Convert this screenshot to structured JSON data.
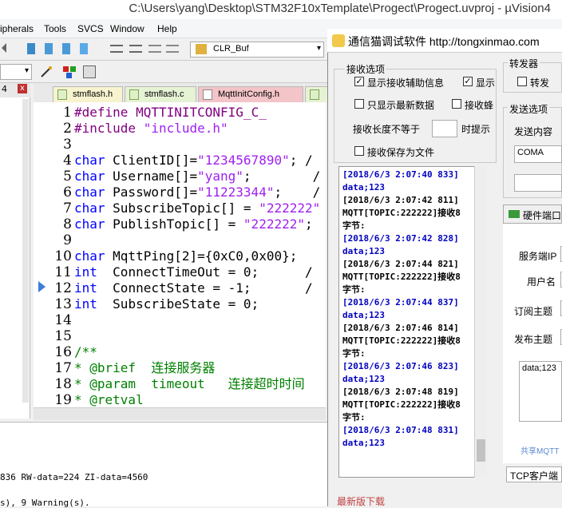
{
  "keil": {
    "title": "C:\\Users\\yang\\Desktop\\STM32F10xTemplate\\Progect\\Progect.uvproj - µVision4",
    "menu": [
      "ipherals",
      "Tools",
      "SVCS",
      "Window",
      "Help"
    ],
    "target_combo": "CLR_Buf",
    "tabs": [
      "stmflash.h",
      "stmflash.c",
      "MqttInitConfig.h"
    ],
    "code_lines": [
      {
        "n": "1",
        "text": "#define MQTTINITCONFIG_C_"
      },
      {
        "n": "2",
        "text": "#include \"include.h\""
      },
      {
        "n": "3",
        "text": ""
      },
      {
        "n": "4",
        "text": "char ClientID[]=\"1234567890\"; /"
      },
      {
        "n": "5",
        "text": "char Username[]=\"yang\";        /"
      },
      {
        "n": "6",
        "text": "char Password[]=\"11223344\";    /"
      },
      {
        "n": "7",
        "text": "char SubscribeTopic[] = \"222222\""
      },
      {
        "n": "8",
        "text": "char PublishTopic[] = \"222222\";"
      },
      {
        "n": "9",
        "text": ""
      },
      {
        "n": "10",
        "text": "char MqttPing[2]={0xC0,0x00};"
      },
      {
        "n": "11",
        "text": "int  ConnectTimeOut = 0;      /"
      },
      {
        "n": "12",
        "text": "int  ConnectState = -1;       /"
      },
      {
        "n": "13",
        "text": "int  SubscribeState = 0;"
      },
      {
        "n": "14",
        "text": ""
      },
      {
        "n": "15",
        "text": ""
      },
      {
        "n": "16",
        "text": "/**"
      },
      {
        "n": "17",
        "text": "* @brief  连接服务器"
      },
      {
        "n": "18",
        "text": "* @param  timeout   连接超时时间"
      },
      {
        "n": "19",
        "text": "* @retval"
      }
    ],
    "output": [
      "836 RW-data=224 ZI-data=4560",
      "s), 9 Warning(s)."
    ],
    "left_panel_marks": [
      "4",
      "x"
    ]
  },
  "tool": {
    "title": "通信猫调试软件  http://tongxinmao.com",
    "recv_group": "接收选项",
    "show_recv_info": "显示接收辅助信息",
    "show_recv_info_checked": true,
    "show2": "显示",
    "show2_checked": true,
    "only_latest": "只显示最新数据",
    "recv_bee": "接收蜂",
    "recv_len_label": "接收长度不等于",
    "recv_len_value": "",
    "recv_len_hint": "时提示",
    "save_to_file": "接收保存为文件",
    "forward_group": "转发器",
    "forward_cb": "转发",
    "send_group": "发送选项",
    "send_content_label": "发送内容",
    "send_content_value": "COMA",
    "hw_tab": "硬件端口",
    "server_ip": "服务端IP",
    "username": "用户名",
    "sub_topic": "订阅主题",
    "pub_topic": "发布主题",
    "send_text": "data;123",
    "share_link": "共享MQTT",
    "tcp_tab": "TCP客户端",
    "download": "最新版下载",
    "log": [
      {
        "text": "[2018/6/3 2:07:40 833]",
        "blue": true
      },
      {
        "text": "data;123",
        "blue": true
      },
      {
        "text": "[2018/6/3 2:07:42 811]",
        "blue": false
      },
      {
        "text": "MQTT[TOPIC:222222]接收8",
        "blue": false
      },
      {
        "text": "字节:",
        "blue": false
      },
      {
        "text": "[2018/6/3 2:07:42 828]",
        "blue": true
      },
      {
        "text": "data;123",
        "blue": true
      },
      {
        "text": "[2018/6/3 2:07:44 821]",
        "blue": false
      },
      {
        "text": "MQTT[TOPIC:222222]接收8",
        "blue": false
      },
      {
        "text": "字节:",
        "blue": false
      },
      {
        "text": "[2018/6/3 2:07:44 837]",
        "blue": true
      },
      {
        "text": "data;123",
        "blue": true
      },
      {
        "text": "[2018/6/3 2:07:46 814]",
        "blue": false
      },
      {
        "text": "MQTT[TOPIC:222222]接收8",
        "blue": false
      },
      {
        "text": "字节:",
        "blue": false
      },
      {
        "text": "[2018/6/3 2:07:46 823]",
        "blue": true
      },
      {
        "text": "data;123",
        "blue": true
      },
      {
        "text": "[2018/6/3 2:07:48 819]",
        "blue": false
      },
      {
        "text": "MQTT[TOPIC:222222]接收8",
        "blue": false
      },
      {
        "text": "字节:",
        "blue": false
      },
      {
        "text": "[2018/6/3 2:07:48 831]",
        "blue": true
      },
      {
        "text": "data;123",
        "blue": true
      }
    ]
  }
}
